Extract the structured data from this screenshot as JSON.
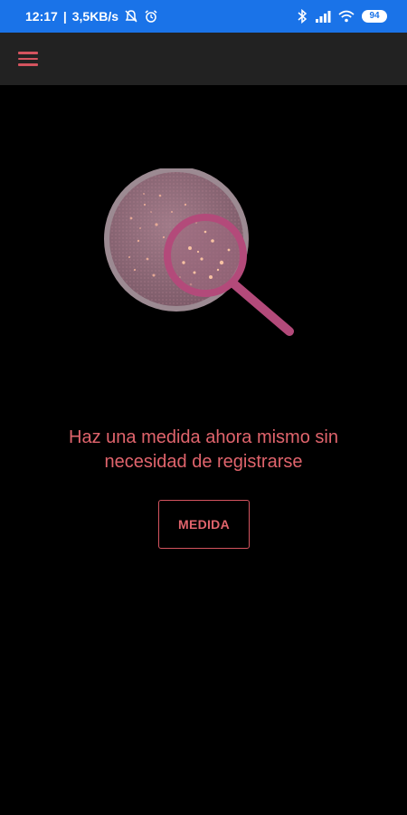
{
  "status_bar": {
    "time": "12:17",
    "speed": "3,5KB/s",
    "battery": "94",
    "icons": [
      "alarm-off-icon",
      "alarm-icon",
      "bluetooth-icon",
      "signal-icon",
      "wifi-icon",
      "battery-icon"
    ]
  },
  "app_bar": {
    "menu_icon": "hamburger-menu-icon"
  },
  "main": {
    "illustration": "magnifier-on-petri-dish-icon",
    "message_lines": [
      "Haz una medida ahora mismo sin",
      "necesidad de registrarse"
    ],
    "button_label": "MEDIDA"
  },
  "colors": {
    "status_bar": "#1a73e8",
    "app_bar": "#222222",
    "background": "#000000",
    "accent": "#e0646c",
    "dish": "#8e6a78",
    "magnifier": "#b34a7a"
  }
}
